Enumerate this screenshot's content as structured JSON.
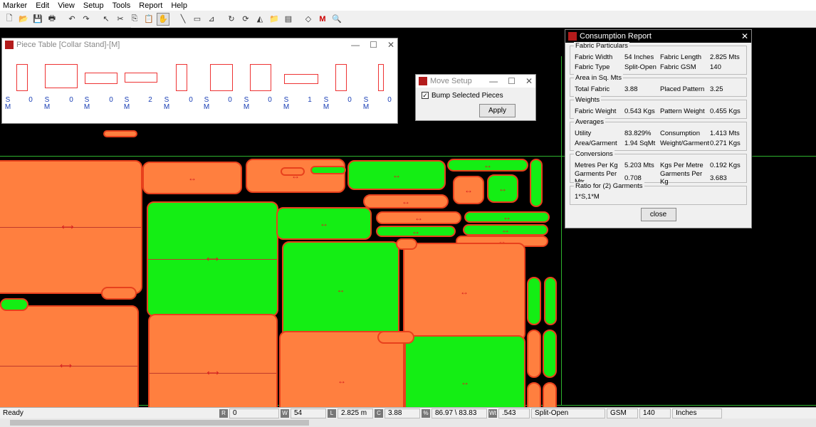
{
  "menu": [
    "Marker",
    "Edit",
    "View",
    "Setup",
    "Tools",
    "Report",
    "Help"
  ],
  "toolbar": {
    "icons": [
      "new-icon",
      "open-icon",
      "save-icon",
      "print-icon",
      "undo-icon",
      "redo-icon",
      "pointer-icon",
      "cut-icon",
      "copy-icon",
      "paste-icon",
      "hand-icon",
      "line-icon",
      "marker-icon",
      "measure-icon",
      "refresh-icon",
      "rotate-icon",
      "flip-icon",
      "folder-icon",
      "report-icon",
      "zoom-icon",
      "mirror-icon",
      "search-icon"
    ],
    "glyphs": [
      "🗋",
      "📂",
      "💾",
      "🖶",
      "↶",
      "↷",
      "↖",
      "✂",
      "⎘",
      "📋",
      "✋",
      "╲",
      "▭",
      "⊿",
      "↻",
      "⟳",
      "◭",
      "📁",
      "▤",
      "◇",
      "M",
      "🔍"
    ]
  },
  "subtools": [
    "✥",
    "↔",
    "↑"
  ],
  "piece_table": {
    "title": "Piece Table [Collar Stand]-[M]",
    "labels": [
      {
        "top": "S",
        "mid": "0",
        "bot": "M"
      },
      {
        "top": "S",
        "mid": "0",
        "bot": "M"
      },
      {
        "top": "S",
        "mid": "0",
        "bot": "M"
      },
      {
        "top": "S",
        "mid": "2",
        "bot": "M"
      },
      {
        "top": "S",
        "mid": "0",
        "bot": "M"
      },
      {
        "top": "S",
        "mid": "0",
        "bot": "M"
      },
      {
        "top": "S",
        "mid": "0",
        "bot": "M"
      },
      {
        "top": "S",
        "mid": "1",
        "bot": "M"
      },
      {
        "top": "S",
        "mid": "0",
        "bot": "M"
      },
      {
        "top": "S",
        "mid": "0",
        "bot": "M"
      }
    ]
  },
  "move_setup": {
    "title": "Move Setup",
    "checkbox_label": "Bump Selected Pieces",
    "checked": true,
    "apply_label": "Apply"
  },
  "consumption": {
    "title": "Consumption Report",
    "groups": [
      {
        "title": "Fabric Particulars",
        "rows": [
          [
            "Fabric Width",
            "54 Inches",
            "Fabric Length",
            "2.825 Mts"
          ],
          [
            "Fabric Type",
            "Split-Open",
            "Fabric GSM",
            "140"
          ]
        ]
      },
      {
        "title": "Area in Sq. Mts",
        "rows": [
          [
            "Total Fabric",
            "3.88",
            "Placed Pattern",
            "3.25"
          ]
        ]
      },
      {
        "title": "Weights",
        "rows": [
          [
            "Fabric Weight",
            "0.543 Kgs",
            "Pattern Weight",
            "0.455 Kgs"
          ]
        ]
      },
      {
        "title": "Averages",
        "rows": [
          [
            "Utility",
            "83.829%",
            "Consumption",
            "1.413 Mts"
          ],
          [
            "Area/Garment",
            "1.94 SqMt",
            "Weight/Garment",
            "0.271 Kgs"
          ]
        ]
      },
      {
        "title": "Conversions",
        "rows": [
          [
            "Metres Per Kg",
            "5.203 Mts",
            "Kgs Per Metre",
            "0.192 Kgs"
          ],
          [
            "Garments Per Mtr",
            "0.708",
            "Garments Per Kg",
            "3.683"
          ]
        ]
      }
    ],
    "ratio_title": "Ratio for (2) Garments",
    "ratio_value": "1*S,1*M",
    "close_label": "close"
  },
  "status": {
    "ready": "Ready",
    "r_icon": "R",
    "r_value": "0",
    "w_icon": "W",
    "w_value": "54",
    "l_icon": "L",
    "l_value": "2.825 m",
    "c_icon": "C",
    "c_value": "3.88",
    "pct_icon": "%",
    "pct_value": "86.97 \\ 83.83",
    "wt_icon": "Wt",
    "wt_value": ".543",
    "type_value": "Split-Open",
    "gsm_label": "GSM",
    "gsm_value": "140",
    "unit_value": "Inches"
  },
  "colors": {
    "piece_orange": "#ff7f3f",
    "piece_green": "#14ee14",
    "outline": "#e8401c",
    "marker_line": "#2db32d"
  }
}
